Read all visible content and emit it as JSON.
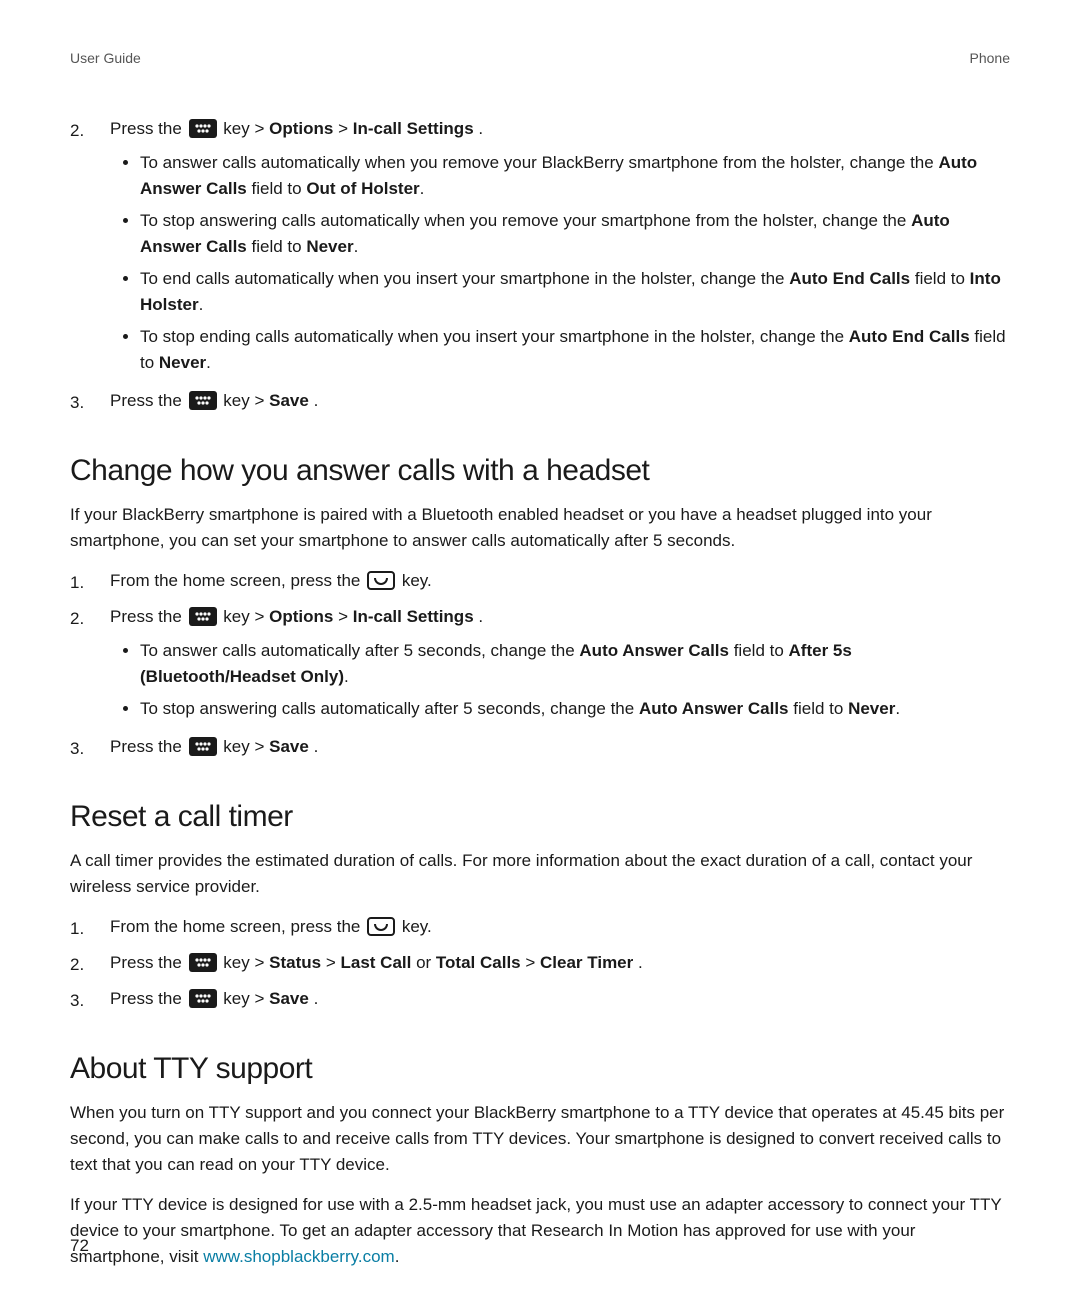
{
  "header": {
    "left": "User Guide",
    "right": "Phone"
  },
  "page_number": "72",
  "section_a": {
    "step2": {
      "num": "2.",
      "pre": "Press the ",
      "post_a": " key > ",
      "b1": "Options",
      "sep": " > ",
      "b2": "In-call Settings",
      "end": ".",
      "bullets": [
        {
          "t1": "To answer calls automatically when you remove your BlackBerry smartphone from the holster, change the ",
          "b1": "Auto Answer Calls",
          "t2": " field to ",
          "b2": "Out of Holster",
          "t3": "."
        },
        {
          "t1": "To stop answering calls automatically when you remove your smartphone from the holster, change the ",
          "b1": "Auto Answer Calls",
          "t2": " field to ",
          "b2": "Never",
          "t3": "."
        },
        {
          "t1": "To end calls automatically when you insert your smartphone in the holster, change the ",
          "b1": "Auto End Calls",
          "t2": " field to ",
          "b2": "Into Holster",
          "t3": "."
        },
        {
          "t1": "To stop ending calls automatically when you insert your smartphone in the holster, change the ",
          "b1": "Auto End Calls",
          "t2": " field to ",
          "b2": "Never",
          "t3": "."
        }
      ]
    },
    "step3": {
      "num": "3.",
      "pre": "Press the ",
      "post_a": " key > ",
      "b1": "Save",
      "end": "."
    }
  },
  "section_b": {
    "title": "Change how you answer calls with a headset",
    "intro": "If your BlackBerry smartphone is paired with a Bluetooth enabled headset or you have a headset plugged into your smartphone, you can set your smartphone to answer calls automatically after 5 seconds.",
    "step1": {
      "num": "1.",
      "pre": "From the home screen, press the ",
      "post": " key."
    },
    "step2": {
      "num": "2.",
      "pre": "Press the ",
      "post_a": " key > ",
      "b1": "Options",
      "sep": " > ",
      "b2": "In-call Settings",
      "end": ".",
      "bullets": [
        {
          "t1": "To answer calls automatically after 5 seconds, change the ",
          "b1": "Auto Answer Calls",
          "t2": " field to ",
          "b2": "After 5s (Bluetooth/Headset Only)",
          "t3": "."
        },
        {
          "t1": "To stop answering calls automatically after 5 seconds, change the ",
          "b1": "Auto Answer Calls",
          "t2": " field to ",
          "b2": "Never",
          "t3": "."
        }
      ]
    },
    "step3": {
      "num": "3.",
      "pre": "Press the ",
      "post_a": " key > ",
      "b1": "Save",
      "end": "."
    }
  },
  "section_c": {
    "title": "Reset a call timer",
    "intro": "A call timer provides the estimated duration of calls. For more information about the exact duration of a call, contact your wireless service provider.",
    "step1": {
      "num": "1.",
      "pre": "From the home screen, press the ",
      "post": " key."
    },
    "step2": {
      "num": "2.",
      "pre": "Press the ",
      "post_a": " key > ",
      "b1": "Status",
      "sep1": " > ",
      "b2": "Last Call",
      "or": " or ",
      "b3": "Total Calls",
      "sep2": " > ",
      "b4": "Clear Timer",
      "end": "."
    },
    "step3": {
      "num": "3.",
      "pre": "Press the ",
      "post_a": " key > ",
      "b1": "Save",
      "end": "."
    }
  },
  "section_d": {
    "title": "About TTY support",
    "p1": "When you turn on TTY support and you connect your BlackBerry smartphone to a TTY device that operates at 45.45 bits per second, you can make calls to and receive calls from TTY devices. Your smartphone is designed to convert received calls to text that you can read on your TTY device.",
    "p2_a": "If your TTY device is designed for use with a 2.5-mm headset jack, you must use an adapter accessory to connect your TTY device to your smartphone. To get an adapter accessory that Research In Motion has approved for use with your smartphone, visit ",
    "p2_link": "www.shopblackberry.com",
    "p2_b": "."
  }
}
